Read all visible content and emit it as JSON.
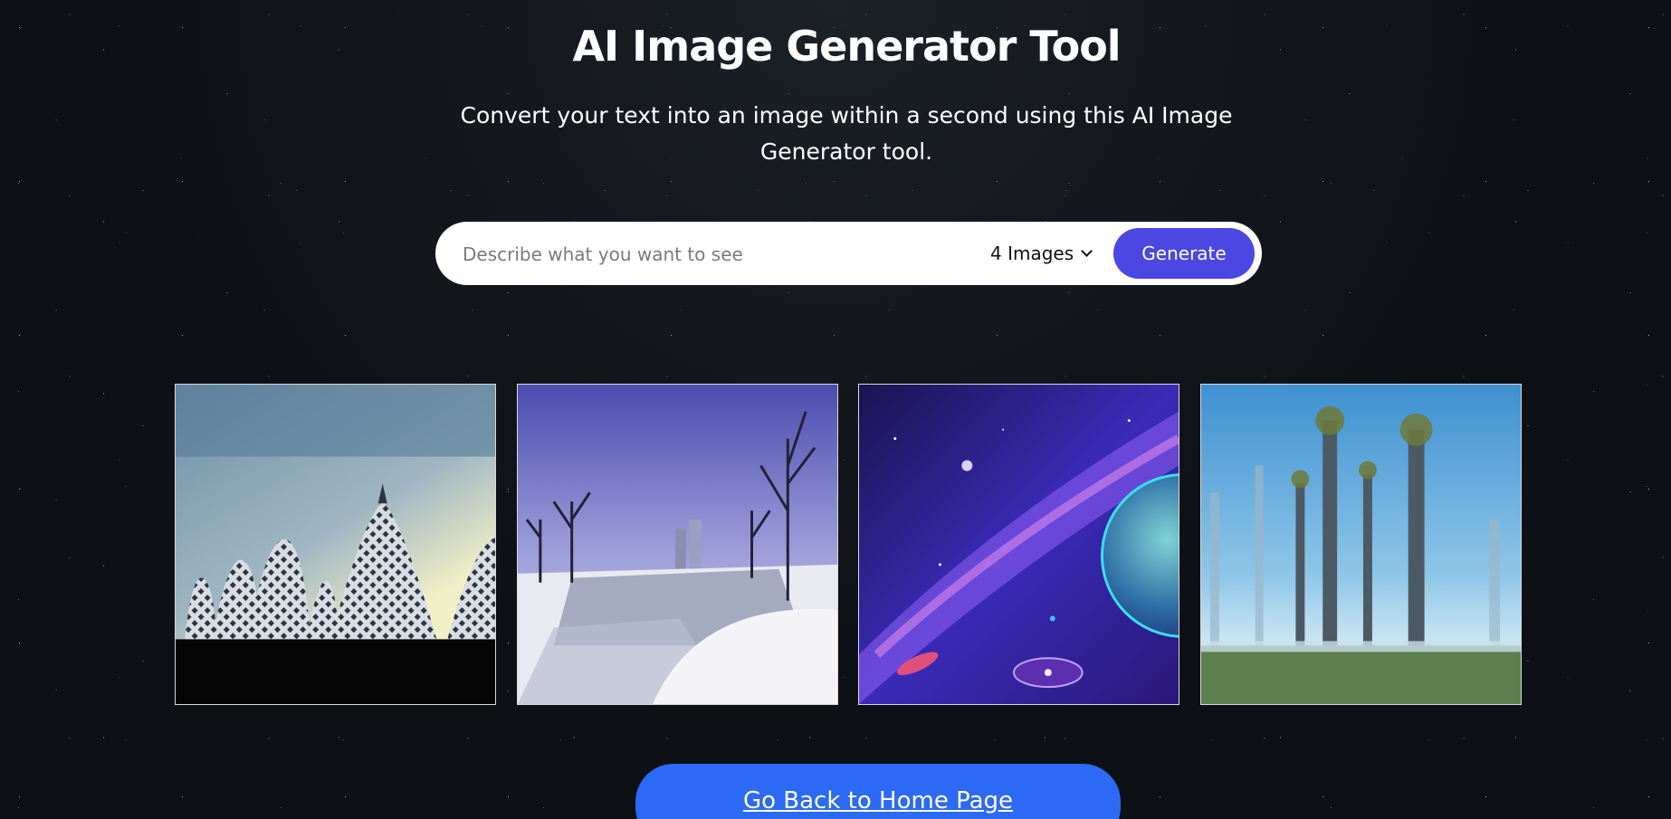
{
  "header": {
    "title": "AI Image Generator Tool",
    "subtitle": "Convert your text into an image within a second using this AI Image Generator tool."
  },
  "search": {
    "placeholder": "Describe what you want to see",
    "value": "",
    "image_count": "4 Images",
    "generate_label": "Generate"
  },
  "gallery": {
    "images": [
      {
        "subject": "futuristic lattice domes at sunset"
      },
      {
        "subject": "snowy river with bare trees and towers"
      },
      {
        "subject": "galaxy with nebula and planet"
      },
      {
        "subject": "tall trees in misty blue forest"
      }
    ]
  },
  "footer": {
    "home_label": "Go Back to Home Page"
  },
  "colors": {
    "background": "#0d1014",
    "generate_button": "#4a47e3",
    "home_button": "#2c69f5",
    "search_bar": "#ffffff"
  },
  "icons": {
    "count_dropdown": "chevron-down-icon"
  }
}
